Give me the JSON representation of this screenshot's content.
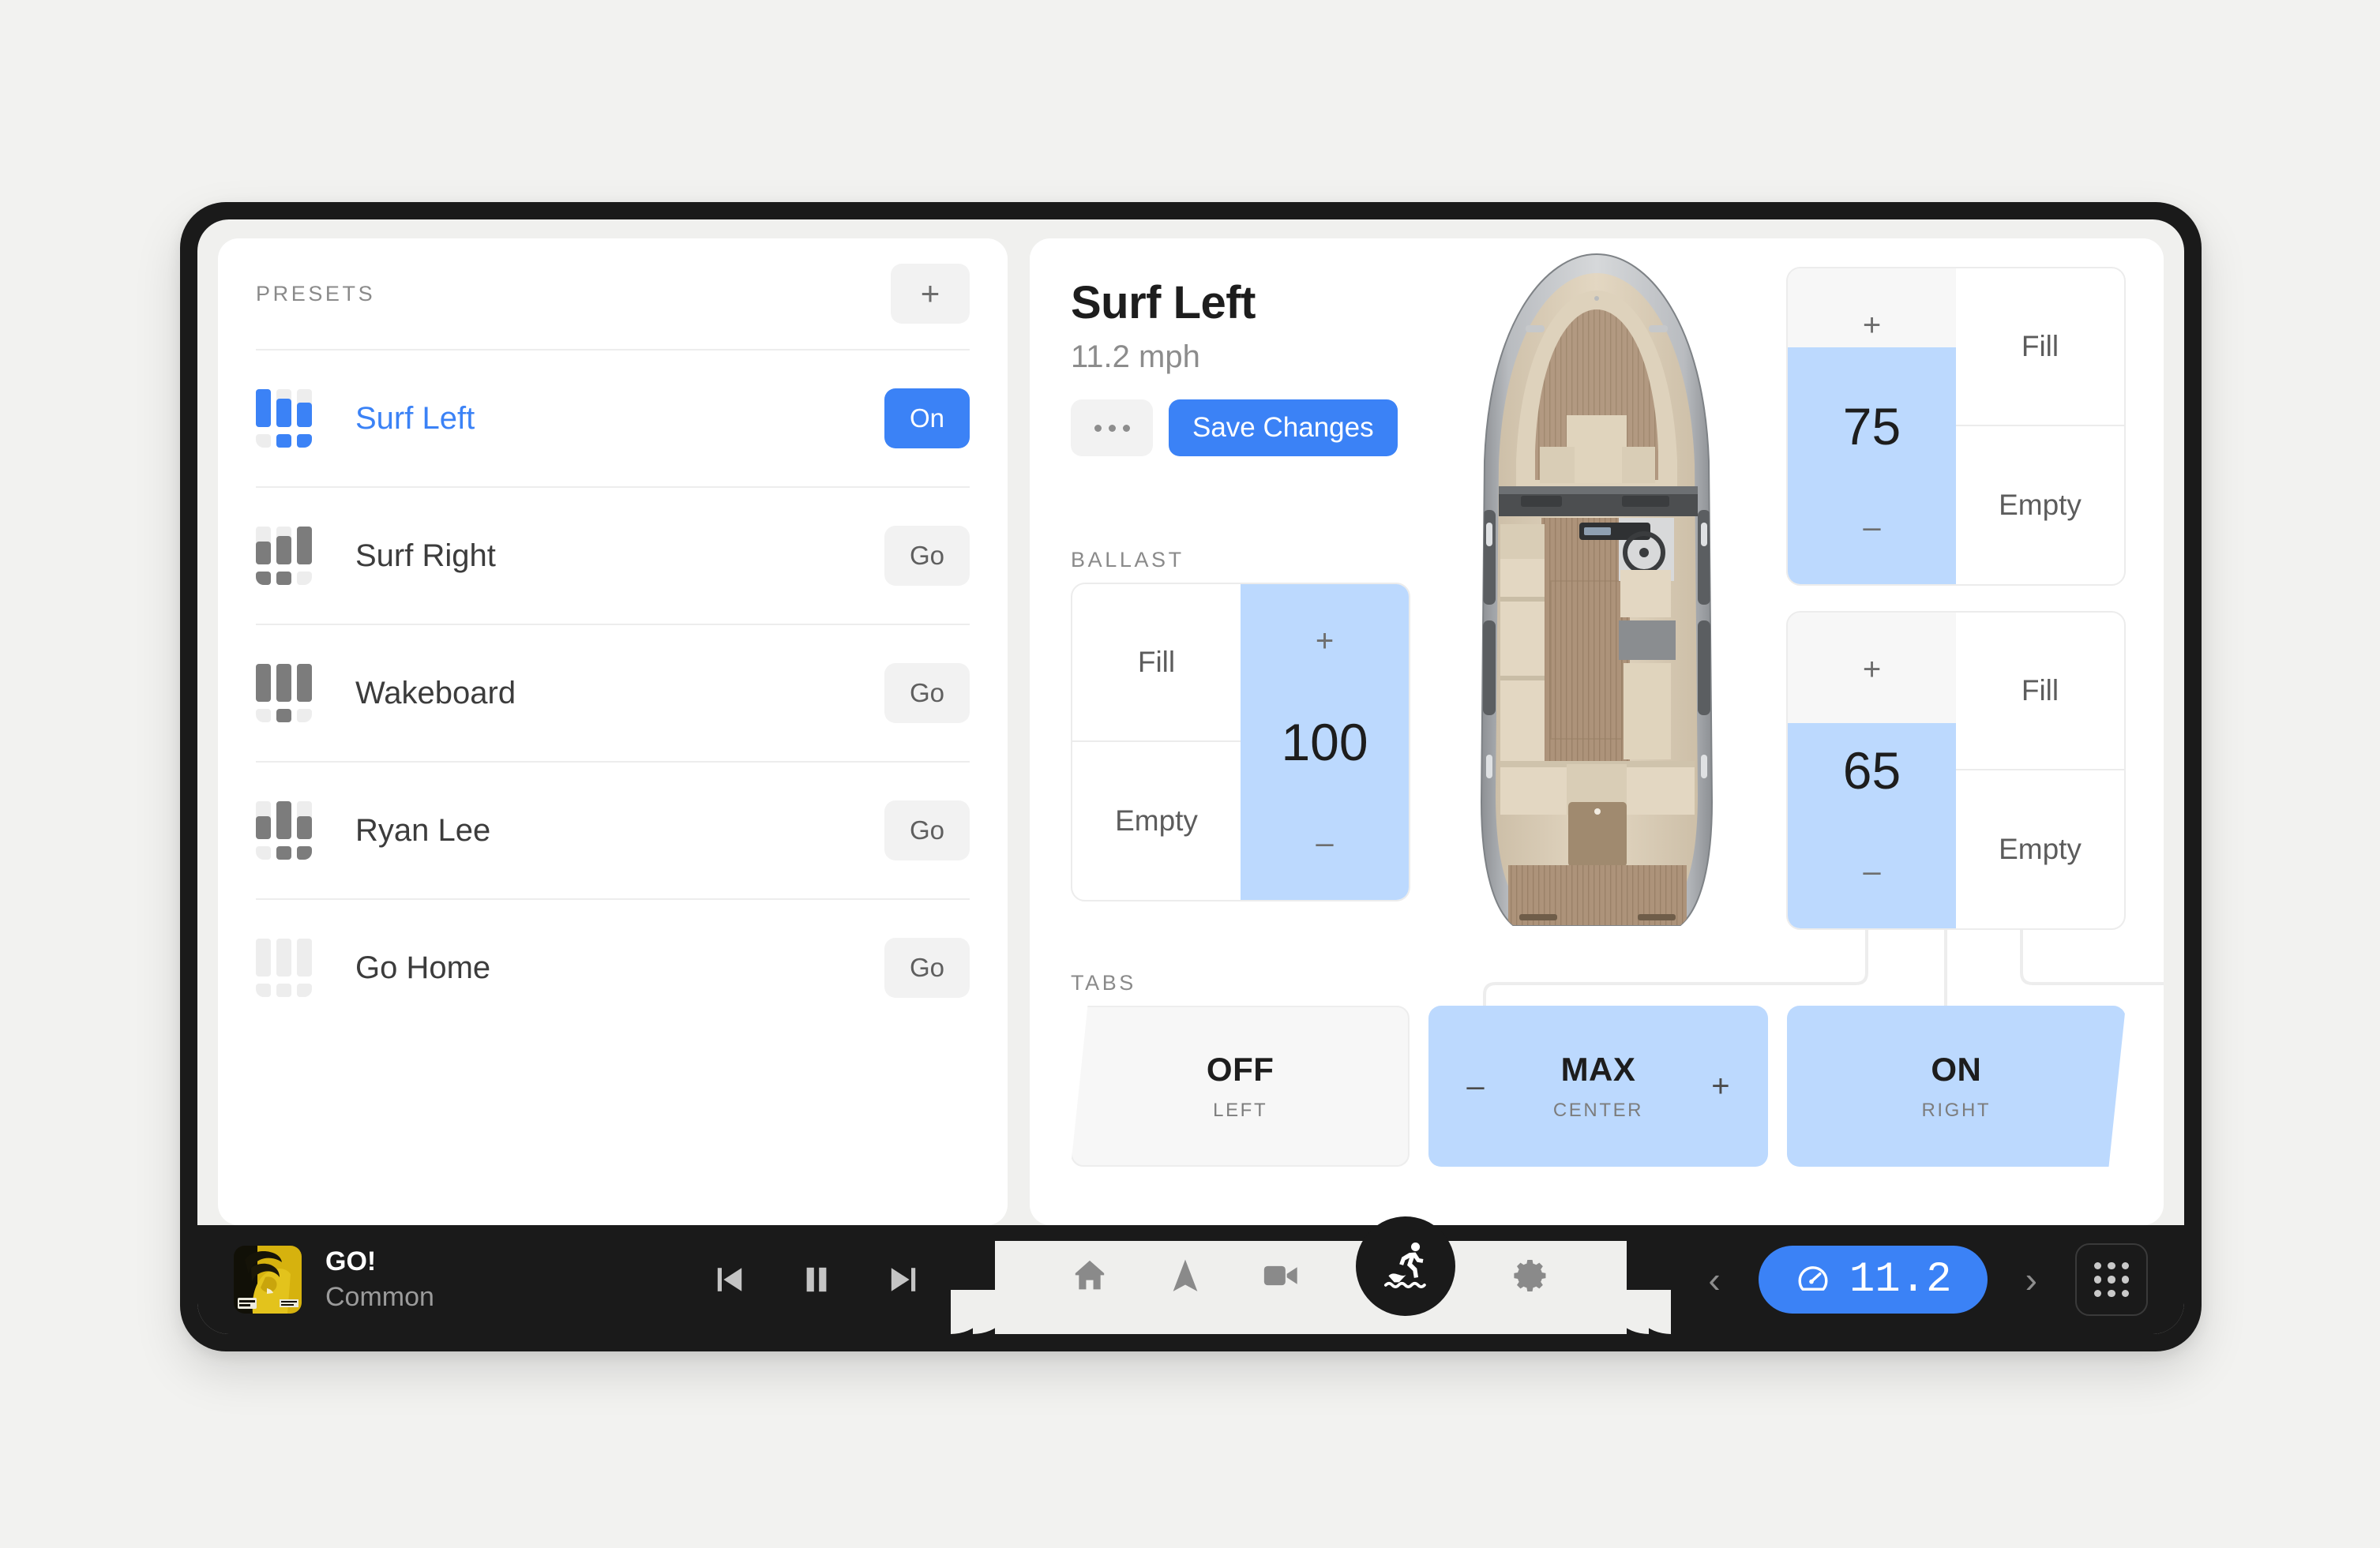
{
  "presets": {
    "section_label": "PRESETS",
    "add_label": "+",
    "items": [
      {
        "name": "Surf Left",
        "action": "On",
        "active": true,
        "bars": [
          100,
          75,
          65
        ],
        "tabs": [
          "off",
          "on",
          "on"
        ]
      },
      {
        "name": "Surf Right",
        "action": "Go",
        "active": false,
        "bars": [
          60,
          75,
          100
        ],
        "tabs": [
          "on",
          "on",
          "off"
        ]
      },
      {
        "name": "Wakeboard",
        "action": "Go",
        "active": false,
        "bars": [
          100,
          100,
          100
        ],
        "tabs": [
          "off",
          "on",
          "off"
        ]
      },
      {
        "name": "Ryan Lee",
        "action": "Go",
        "active": false,
        "bars": [
          60,
          100,
          60
        ],
        "tabs": [
          "off",
          "on",
          "on"
        ]
      },
      {
        "name": "Go Home",
        "action": "Go",
        "active": false,
        "bars": [
          0,
          0,
          0
        ],
        "tabs": [
          "off",
          "off",
          "off"
        ]
      }
    ]
  },
  "detail": {
    "title": "Surf Left",
    "speed": "11.2 mph",
    "more_label": "...",
    "save_label": "Save Changes",
    "ballast_label": "BALLAST",
    "tabs_label": "TABS"
  },
  "ballast": {
    "fill_label": "Fill",
    "empty_label": "Empty",
    "plus_label": "+",
    "minus_label": "–",
    "tanks": [
      {
        "position": "left",
        "value": "100",
        "level": 100
      },
      {
        "position": "front-right",
        "value": "75",
        "level": 75
      },
      {
        "position": "rear-right",
        "value": "65",
        "level": 65
      }
    ]
  },
  "tabs": {
    "items": [
      {
        "state": "OFF",
        "zone": "LEFT",
        "active": false,
        "has_stepper": false
      },
      {
        "state": "MAX",
        "zone": "CENTER",
        "active": true,
        "has_stepper": true
      },
      {
        "state": "ON",
        "zone": "RIGHT",
        "active": true,
        "has_stepper": false
      }
    ],
    "dec_label": "–",
    "inc_label": "+"
  },
  "bottom_bar": {
    "media": {
      "title": "GO!",
      "artist": "Common",
      "previous_icon": "skip-previous-icon",
      "play_pause_icon": "pause-icon",
      "next_icon": "skip-next-icon"
    },
    "nav": [
      {
        "icon": "home-icon",
        "active": false
      },
      {
        "icon": "navigate-icon",
        "active": false
      },
      {
        "icon": "camera-icon",
        "active": false
      },
      {
        "icon": "surfer-icon",
        "active": true
      },
      {
        "icon": "gear-icon",
        "active": false
      }
    ],
    "right": {
      "prev_label": "‹",
      "next_label": "›",
      "speed_icon": "speedometer-icon",
      "speed_value": "11.2",
      "apps_icon": "grid-apps-icon"
    }
  },
  "colors": {
    "accent": "#3b82f6",
    "accent_light": "#bcd9fe",
    "panel": "#ffffff",
    "page_bg": "#f2f2f0",
    "bezel": "#1a1a1a",
    "muted_text": "#8a8a8a"
  }
}
